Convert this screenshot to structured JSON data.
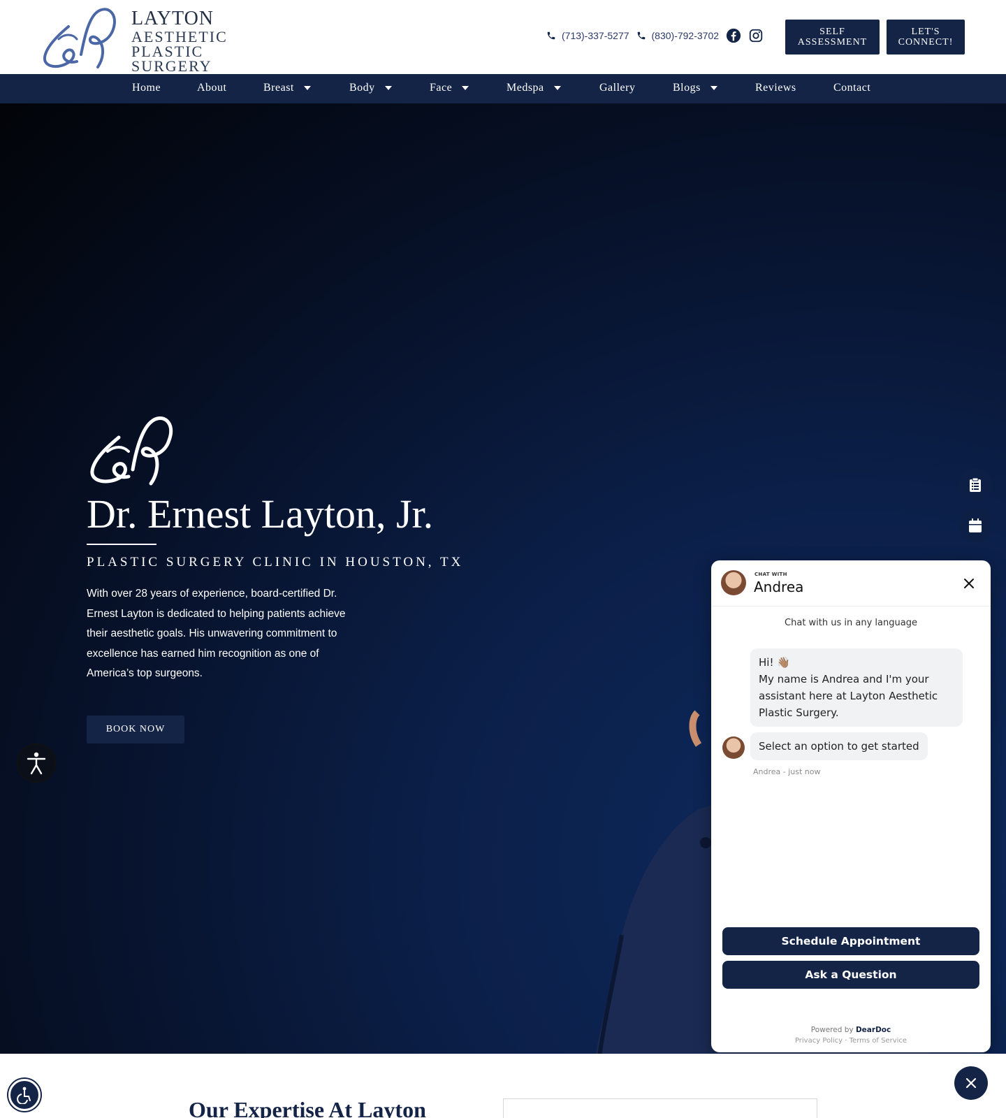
{
  "header": {
    "logo": {
      "line1": "LAYTON",
      "line2": "AESTHETIC",
      "line3": "PLASTIC",
      "line4": "SURGERY"
    },
    "phones": [
      "(713)-337-5277",
      "(830)-792-3702"
    ],
    "social_icons": [
      "facebook-icon",
      "instagram-icon"
    ],
    "buttons": {
      "self_assessment_line1": "SELF",
      "self_assessment_line2": "ASSESSMENT",
      "connect_line1": "LET'S",
      "connect_line2": "CONNECT!"
    }
  },
  "nav": {
    "items": [
      {
        "label": "Home",
        "dropdown": false
      },
      {
        "label": "About",
        "dropdown": false
      },
      {
        "label": "Breast",
        "dropdown": true
      },
      {
        "label": "Body",
        "dropdown": true
      },
      {
        "label": "Face",
        "dropdown": true
      },
      {
        "label": "Medspa",
        "dropdown": true
      },
      {
        "label": "Gallery",
        "dropdown": false
      },
      {
        "label": "Blogs",
        "dropdown": true
      },
      {
        "label": "Reviews",
        "dropdown": false
      },
      {
        "label": "Contact",
        "dropdown": false
      }
    ]
  },
  "hero": {
    "title": "Dr. Ernest Layton, Jr.",
    "subtitle": "PLASTIC SURGERY CLINIC IN HOUSTON, TX",
    "description": "With over 28 years of experience, board-certified Dr. Ernest Layton is dedicated to helping patients achieve their aesthetic goals. His unwavering commitment to excellence has earned him recognition as one of America’s top surgeons.",
    "cta": "BOOK NOW"
  },
  "chat": {
    "chat_with": "CHAT WITH",
    "agent_name": "Andrea",
    "language_note": "Chat with us in any language",
    "greeting_line": "Hi! 👋🏽",
    "greeting_body": "My name is Andrea and I'm your assistant here at Layton Aesthetic Plastic Surgery.",
    "prompt": "Select an option to get started",
    "meta": "Andrea - just now",
    "actions": {
      "schedule": "Schedule Appointment",
      "ask": "Ask a Question"
    },
    "powered_prefix": "Powered by ",
    "powered_brand": "DearDoc",
    "privacy": "Privacy Policy",
    "separator": " · ",
    "terms": "Terms of Service"
  },
  "below": {
    "expertise_heading": "Our Expertise At Layton"
  },
  "colors": {
    "navy": "#142447",
    "hero_dark": "#020408",
    "hero_blue": "#0e2a5e",
    "white": "#ffffff"
  }
}
